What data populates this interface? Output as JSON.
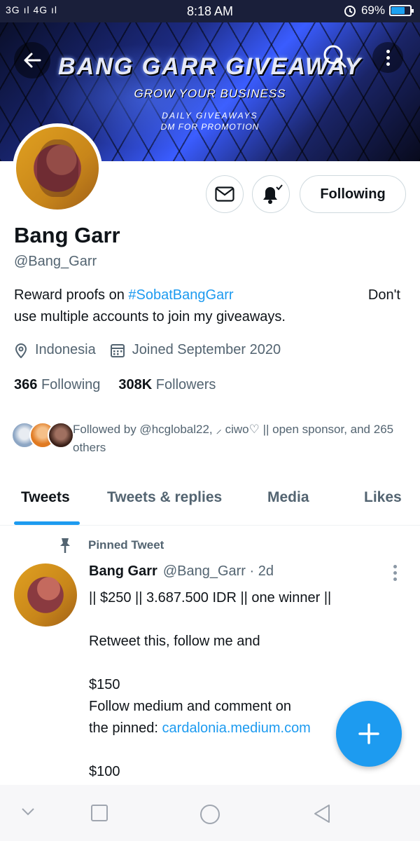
{
  "status_bar": {
    "signal": "3G ıl 4G ıl",
    "time": "8:18 AM",
    "battery": "69%"
  },
  "banner": {
    "title": "BANG GARR GIVEAWAY",
    "subtitle": "GROW YOUR BUSINESS",
    "line1": "DAILY GIVEAWAYS",
    "line2": "DM FOR PROMOTION"
  },
  "actions": {
    "message_icon": "mail-icon",
    "notify_icon": "bell-icon",
    "follow_label": "Following"
  },
  "profile": {
    "name": "Bang Garr",
    "handle": "@Bang_Garr",
    "bio_prefix": "Reward proofs on ",
    "bio_tag": "#SobatBangGarr",
    "bio_right": "Don't",
    "bio_line2": "use multiple accounts to join my giveaways.",
    "location": "Indonesia",
    "joined": "Joined September 2020",
    "following_count": "366",
    "following_label": "Following",
    "followers_count": "308K",
    "followers_label": "Followers",
    "followed_by": "Followed by @hcglobal22, ⸝͏ ciwo♡ || open sponsor, and 265 others"
  },
  "tabs": [
    {
      "label": "Tweets"
    },
    {
      "label": "Tweets & replies"
    },
    {
      "label": "Media"
    },
    {
      "label": "Likes"
    }
  ],
  "tweet": {
    "pinned_label": "Pinned Tweet",
    "author": "Bang Garr",
    "handle_time": "@Bang_Garr · 2d",
    "line1": "|| $250 || 3.687.500 IDR || one winner ||",
    "line2": "",
    "line3": "Retweet this, follow me and",
    "line4": "",
    "line5": "$150",
    "line6": "Follow medium and comment on",
    "line7_prefix": "the pinned: ",
    "line7_link": "cardalonia.medium.com",
    "line8": "",
    "line9": "$100"
  }
}
